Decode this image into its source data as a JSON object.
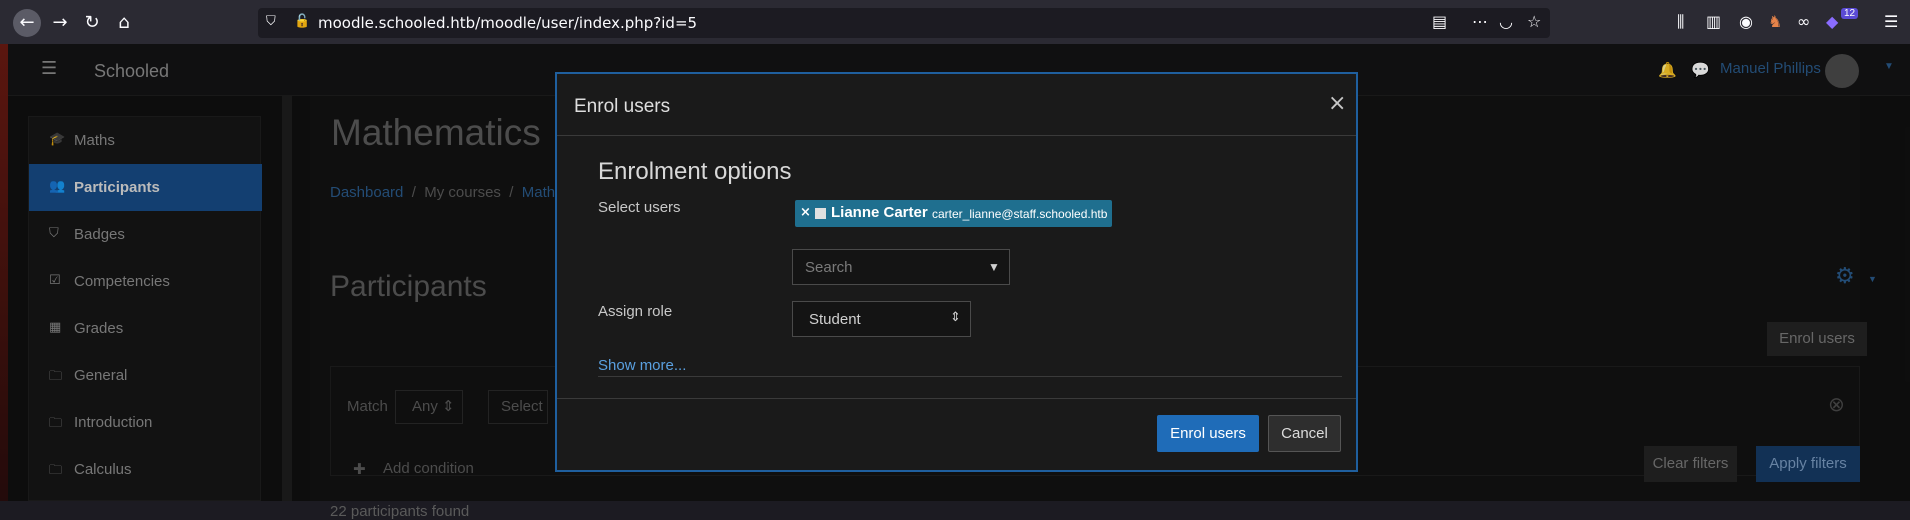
{
  "browser": {
    "url": "moodle.schooled.htb/moodle/user/index.php?id=5",
    "notification_count": "12"
  },
  "navbar": {
    "app_title": "Schooled",
    "user_name": "Manuel Phillips"
  },
  "sidebar": {
    "items": [
      {
        "label": "Maths",
        "icon": "graduation-cap-icon"
      },
      {
        "label": "Participants",
        "icon": "users-icon"
      },
      {
        "label": "Badges",
        "icon": "shield-icon"
      },
      {
        "label": "Competencies",
        "icon": "checkbox-icon"
      },
      {
        "label": "Grades",
        "icon": "table-icon"
      },
      {
        "label": "General",
        "icon": "folder-icon"
      },
      {
        "label": "Introduction",
        "icon": "folder-icon"
      },
      {
        "label": "Calculus",
        "icon": "folder-icon"
      }
    ]
  },
  "main": {
    "course_title": "Mathematics",
    "breadcrumb": [
      "Dashboard",
      "My courses",
      "Math"
    ],
    "page_heading": "Participants",
    "enrol_users_label": "Enrol users",
    "match_label": "Match",
    "match_value": "Any",
    "select_placeholder": "Select",
    "add_condition_label": "Add condition",
    "clear_filters_label": "Clear filters",
    "apply_filters_label": "Apply filters",
    "participants_found": "22 participants found"
  },
  "modal": {
    "title": "Enrol users",
    "close_symbol": "×",
    "options_heading": "Enrolment options",
    "select_users_label": "Select users",
    "selected_user": {
      "remove_symbol": "×",
      "name": "Lianne Carter",
      "email": "carter_lianne@staff.schooled.htb"
    },
    "search_placeholder": "Search",
    "assign_role_label": "Assign role",
    "role_value": "Student",
    "show_more_label": "Show more...",
    "enrol_button_label": "Enrol users",
    "cancel_button_label": "Cancel"
  },
  "colors": {
    "accent": "#1f6cb8",
    "active_sidebar": "#174b85",
    "chip": "#1f6f8f",
    "link": "#5aa0e0"
  }
}
